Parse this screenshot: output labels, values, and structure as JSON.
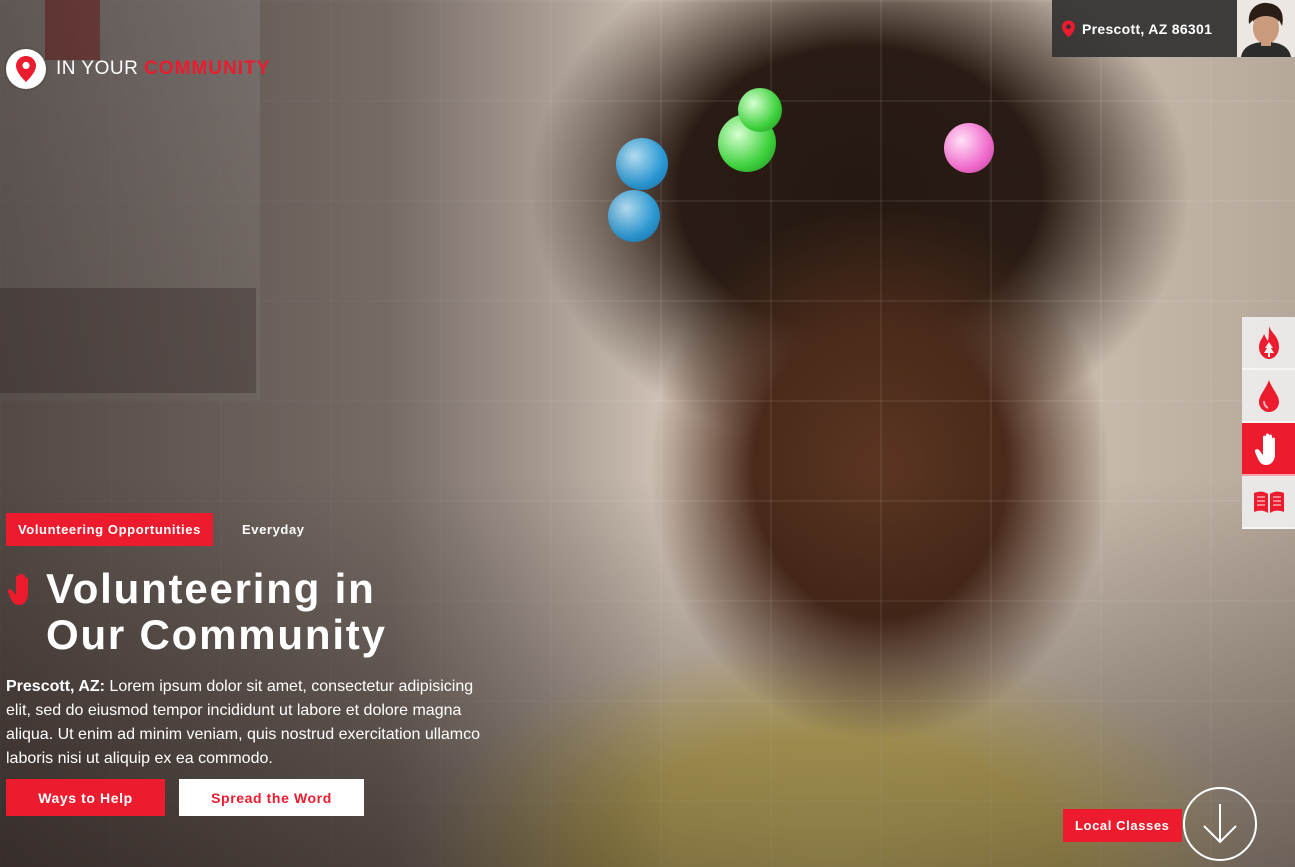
{
  "brand": {
    "prefix": "IN YOUR ",
    "highlight": "COMMUNITY",
    "accent_color": "#ed1b2e"
  },
  "location": {
    "text": "Prescott, AZ 86301",
    "icon": "map-pin-icon"
  },
  "user": {
    "avatar_icon": "user-avatar"
  },
  "side_rail": {
    "items": [
      {
        "icon": "fire-icon",
        "active": false
      },
      {
        "icon": "blood-drop-icon",
        "active": false
      },
      {
        "icon": "hand-icon",
        "active": true
      },
      {
        "icon": "book-icon",
        "active": false
      }
    ]
  },
  "tags": {
    "category": "Volunteering Opportunities",
    "frequency": "Everyday"
  },
  "headline": {
    "line1": "Volunteering in",
    "line2": "Our Community"
  },
  "body": {
    "place": "Prescott, AZ:",
    "text": " Lorem ipsum dolor sit amet, consectetur adipisicing elit, sed do eiusmod tempor incididunt ut labore et dolore magna aliqua. Ut enim ad minim veniam, quis nostrud exercitation ullamco laboris nisi ut aliquip ex ea commodo."
  },
  "buttons": {
    "primary": "Ways to Help",
    "secondary": "Spread the Word"
  },
  "next_section": {
    "label": "Local Classes",
    "icon": "arrow-down-icon"
  }
}
